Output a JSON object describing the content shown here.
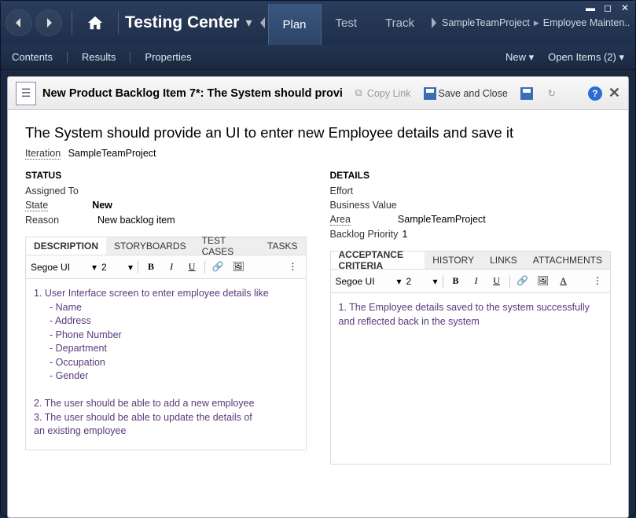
{
  "header": {
    "app_title": "Testing Center",
    "tabs": [
      "Plan",
      "Test",
      "Track"
    ],
    "tab_active": 0,
    "breadcrumb": [
      "SampleTeamProject",
      "Employee Mainten..."
    ]
  },
  "subnav": {
    "left": [
      "Contents",
      "Results",
      "Properties"
    ],
    "right_new": "New",
    "right_open": "Open Items (2)"
  },
  "panel": {
    "title": "New Product Backlog Item 7*: The System should provi",
    "copy_link": "Copy Link",
    "save_close": "Save and Close"
  },
  "item": {
    "title": "The System should provide an UI to enter new Employee details and save it",
    "iteration_label": "Iteration",
    "iteration_value": "SampleTeamProject"
  },
  "status": {
    "heading": "STATUS",
    "assigned_to_label": "Assigned To",
    "assigned_to_value": "",
    "state_label": "State",
    "state_value": "New",
    "reason_label": "Reason",
    "reason_value": "New backlog item"
  },
  "details": {
    "heading": "DETAILS",
    "effort_label": "Effort",
    "effort_value": "",
    "bv_label": "Business Value",
    "bv_value": "",
    "area_label": "Area",
    "area_value": "SampleTeamProject",
    "priority_label": "Backlog Priority",
    "priority_value": "1"
  },
  "left_tabs": [
    "DESCRIPTION",
    "STORYBOARDS",
    "TEST CASES",
    "TASKS"
  ],
  "right_tabs": [
    "ACCEPTANCE CRITERIA",
    "HISTORY",
    "LINKS",
    "ATTACHMENTS"
  ],
  "editor": {
    "font": "Segoe UI",
    "size": "2"
  },
  "description": {
    "line1": "1. User Interface screen to enter employee details like",
    "bullets": [
      "- Name",
      "- Address",
      "- Phone Number",
      "- Department",
      "- Occupation",
      "- Gender"
    ],
    "line2": "2. The user should be able to add a new employee",
    "line3a": "3. The user should be able to update the details of",
    "line3b": "an existing employee"
  },
  "acceptance": {
    "line1": "1. The Employee details saved to the system successfully",
    "line2": "and reflected back in the system"
  }
}
